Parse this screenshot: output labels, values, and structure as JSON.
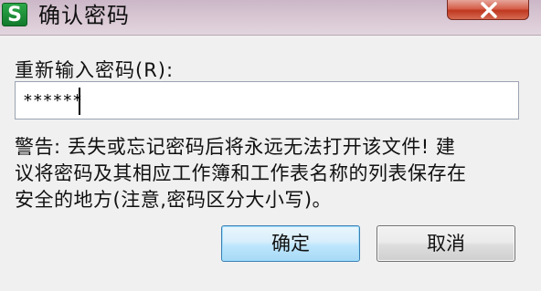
{
  "window": {
    "title": "确认密码",
    "app_icon_letter": "S",
    "close_icon": "close-icon"
  },
  "dialog": {
    "password_label": "重新输入密码(R):",
    "password_value": "******",
    "warning_lines": [
      "警告: 丢失或忘记密码后将永远无法打开该文件! 建",
      "议将密码及其相应工作簿和工作表名称的列表保存在",
      "安全的地方(注意,密码区分大小写)。"
    ],
    "ok_label": "确定",
    "cancel_label": "取消"
  },
  "colors": {
    "app_icon": "#1f8f3a",
    "close_button": "#c8452e",
    "ok_button_border": "#3c7fb1"
  }
}
